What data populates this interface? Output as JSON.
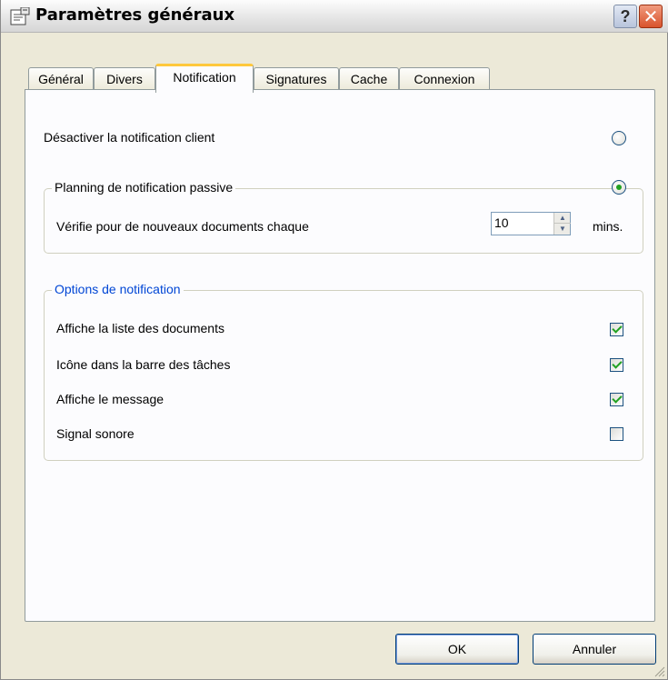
{
  "window": {
    "title": "Paramètres généraux",
    "help_label": "?",
    "close_label": "✕"
  },
  "tabs": [
    {
      "label": "Général"
    },
    {
      "label": "Divers"
    },
    {
      "label": "Notification"
    },
    {
      "label": "Signatures"
    },
    {
      "label": "Cache"
    },
    {
      "label": "Connexion"
    }
  ],
  "active_tab": "Notification",
  "notification": {
    "disable_label": "Désactiver la notification client",
    "disable_selected": false,
    "passive_label": "Planning de notification passive",
    "passive_selected": true,
    "check_label": "Vérifie pour de nouveaux documents chaque",
    "interval_value": "10",
    "interval_unit": "mins."
  },
  "options": {
    "legend": "Options de notification",
    "legend_color": "#0046d5",
    "items": [
      {
        "label": "Affiche la liste des documents",
        "checked": true
      },
      {
        "label": "Icône dans la barre des tâches",
        "checked": true
      },
      {
        "label": "Affiche le message",
        "checked": true
      },
      {
        "label": "Signal sonore",
        "checked": false
      }
    ]
  },
  "buttons": {
    "ok_label": "OK",
    "cancel_label": "Annuler"
  }
}
